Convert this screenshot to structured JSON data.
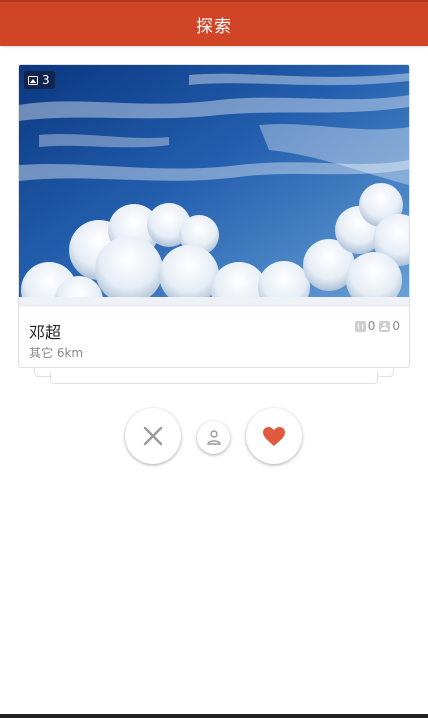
{
  "header": {
    "title": "探索"
  },
  "card": {
    "photo_count": "3",
    "name": "邓超",
    "meta": "其它 6km",
    "stats": {
      "first_count": "0",
      "second_count": "0"
    }
  },
  "actions": {
    "dislike_icon": "close-x-icon",
    "profile_icon": "person-icon",
    "like_icon": "heart-icon"
  },
  "colors": {
    "header_bg": "#cf4526",
    "like_heart": "#e05a3f",
    "dislike_x": "#9a9a9a",
    "profile_icon": "#9a9a9a"
  }
}
